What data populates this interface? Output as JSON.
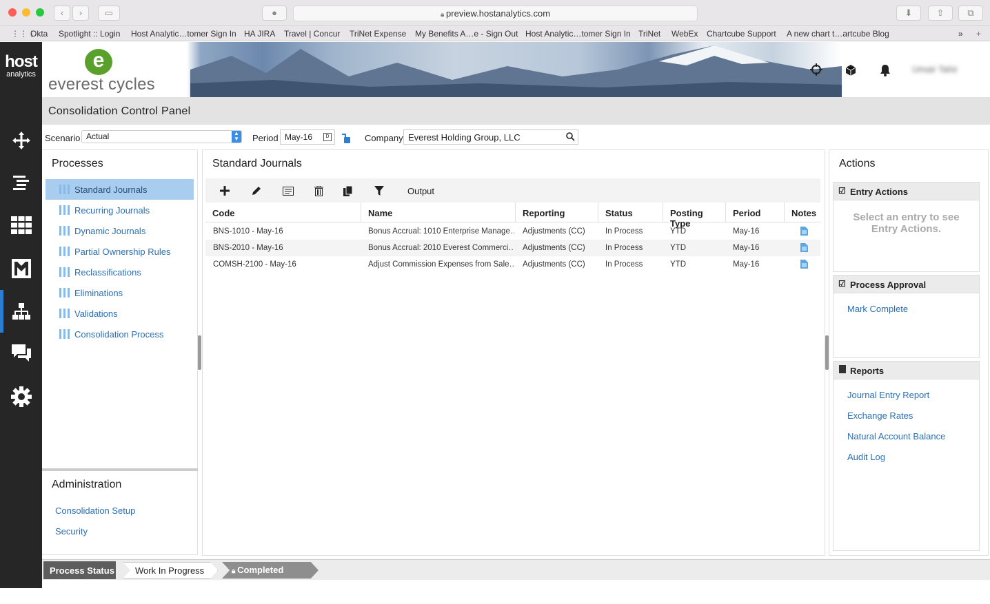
{
  "browser": {
    "url": "preview.hostanalytics.com",
    "bookmarks": [
      "Okta",
      "Spotlight :: Login",
      "Host Analytic…tomer Sign In",
      "HA JIRA",
      "Travel | Concur",
      "TriNet Expense",
      "My Benefits A…e - Sign Out",
      "Host Analytic…tomer Sign In",
      "TriNet",
      "WebEx",
      "Chartcube Support",
      "A new chart t…artcube Blog"
    ]
  },
  "brand": {
    "host_line1": "host",
    "host_line2": "analytics",
    "company_logo_letter": "e",
    "company_name": "everest cycles"
  },
  "header": {
    "user_name": "Umair Tahir"
  },
  "page_title": "Consolidation Control Panel",
  "filters": {
    "scenario_label": "Scenario",
    "scenario_value": "Actual",
    "period_label": "Period",
    "period_value": "May-16",
    "company_label": "Company",
    "company_value": "Everest Holding Group, LLC"
  },
  "processes": {
    "title": "Processes",
    "items": [
      "Standard Journals",
      "Recurring Journals",
      "Dynamic Journals",
      "Partial Ownership Rules",
      "Reclassifications",
      "Eliminations",
      "Validations",
      "Consolidation Process"
    ]
  },
  "admin": {
    "title": "Administration",
    "links": [
      "Consolidation Setup",
      "Security"
    ]
  },
  "journals": {
    "title": "Standard Journals",
    "output_label": "Output",
    "columns": [
      "Code",
      "Name",
      "Reporting",
      "Status",
      "Posting Type",
      "Period",
      "Notes"
    ],
    "rows": [
      [
        "BNS-1010 - May-16",
        "Bonus Accrual: 1010 Enterprise Manage…",
        "Adjustments (CC)",
        "In Process",
        "YTD",
        "May-16"
      ],
      [
        "BNS-2010 - May-16",
        "Bonus Accrual: 2010 Everest Commerci…",
        "Adjustments (CC)",
        "In Process",
        "YTD",
        "May-16"
      ],
      [
        "COMSH-2100 - May-16",
        "Adjust Commission Expenses from Sale…",
        "Adjustments (CC)",
        "In Process",
        "YTD",
        "May-16"
      ]
    ]
  },
  "actions": {
    "title": "Actions",
    "entry_title": "Entry Actions",
    "entry_placeholder": "Select an entry to see Entry Actions.",
    "approval_title": "Process Approval",
    "approval_link": "Mark Complete",
    "reports_title": "Reports",
    "reports": [
      "Journal Entry Report",
      "Exchange Rates",
      "Natural Account Balance",
      "Audit Log"
    ]
  },
  "status": {
    "label": "Process Status",
    "steps": [
      "Work In Progress",
      "Completed"
    ]
  },
  "colors": {
    "accent": "#2a6fb5",
    "active_row": "#a9cdef",
    "sidebar": "#262626",
    "brand_green": "#5aa02c"
  }
}
